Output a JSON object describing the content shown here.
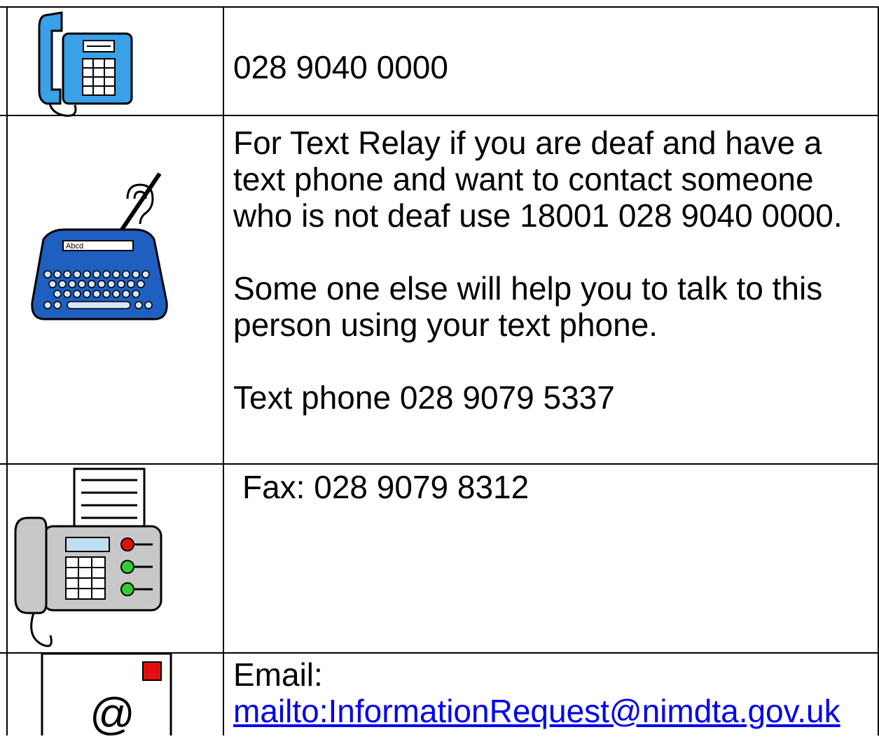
{
  "rows": {
    "phone": {
      "icon": "telephone-icon",
      "text": "028 9040 0000"
    },
    "text_relay": {
      "icon": "text-phone-icon",
      "icon_label": "Abcd",
      "line1": "For Text Relay if you are deaf and have a",
      "line2": "text phone and want to contact someone",
      "line3": "who is not deaf use 18001 028 9040 0000.",
      "line4": "Some one else will help you to talk to this",
      "line5": "person using your text phone.",
      "line6": "Text phone 028 9079 5337"
    },
    "fax": {
      "icon": "fax-machine-icon",
      "text": "Fax: 028 9079 8312"
    },
    "email": {
      "icon": "email-at-icon",
      "label": "Email:",
      "link": "mailto:InformationRequest@nimdta.gov.uk"
    }
  },
  "colors": {
    "phone_blue": "#3aa0e8",
    "textphone_blue": "#1e5fbf",
    "fax_grey": "#c8c8c8",
    "fax_red": "#e01010",
    "fax_green": "#33cc33",
    "email_red": "#e01010",
    "link_blue": "#0000ee"
  }
}
